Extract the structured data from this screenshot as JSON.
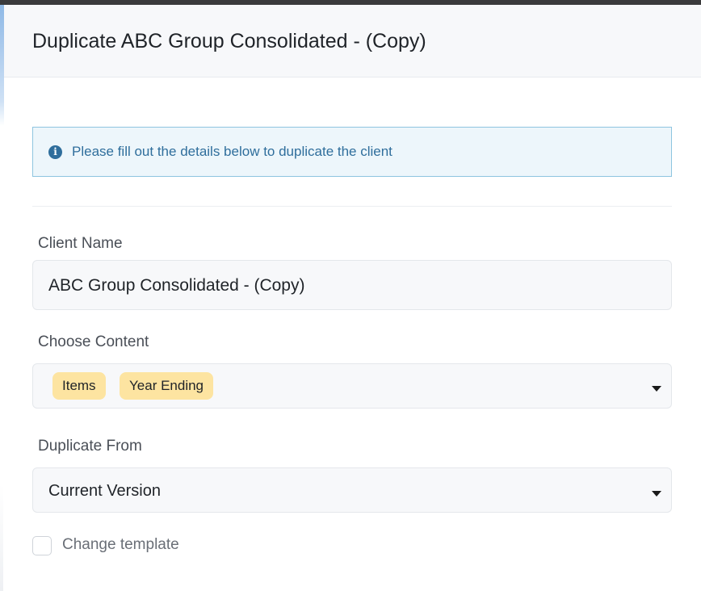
{
  "modal": {
    "title": "Duplicate ABC Group Consolidated - (Copy)"
  },
  "alert": {
    "icon": "info-icon",
    "icon_glyph": "i",
    "message": "Please fill out the details below to duplicate the client",
    "color": "#2f6e9c"
  },
  "client_name": {
    "label": "Client Name",
    "value": "ABC Group Consolidated - (Copy)"
  },
  "choose_content": {
    "label": "Choose Content",
    "selected": [
      "Items",
      "Year Ending"
    ],
    "tag_color": "#fde4a1"
  },
  "duplicate_from": {
    "label": "Duplicate From",
    "value": "Current Version"
  },
  "change_template": {
    "label": "Change template",
    "checked": false
  }
}
